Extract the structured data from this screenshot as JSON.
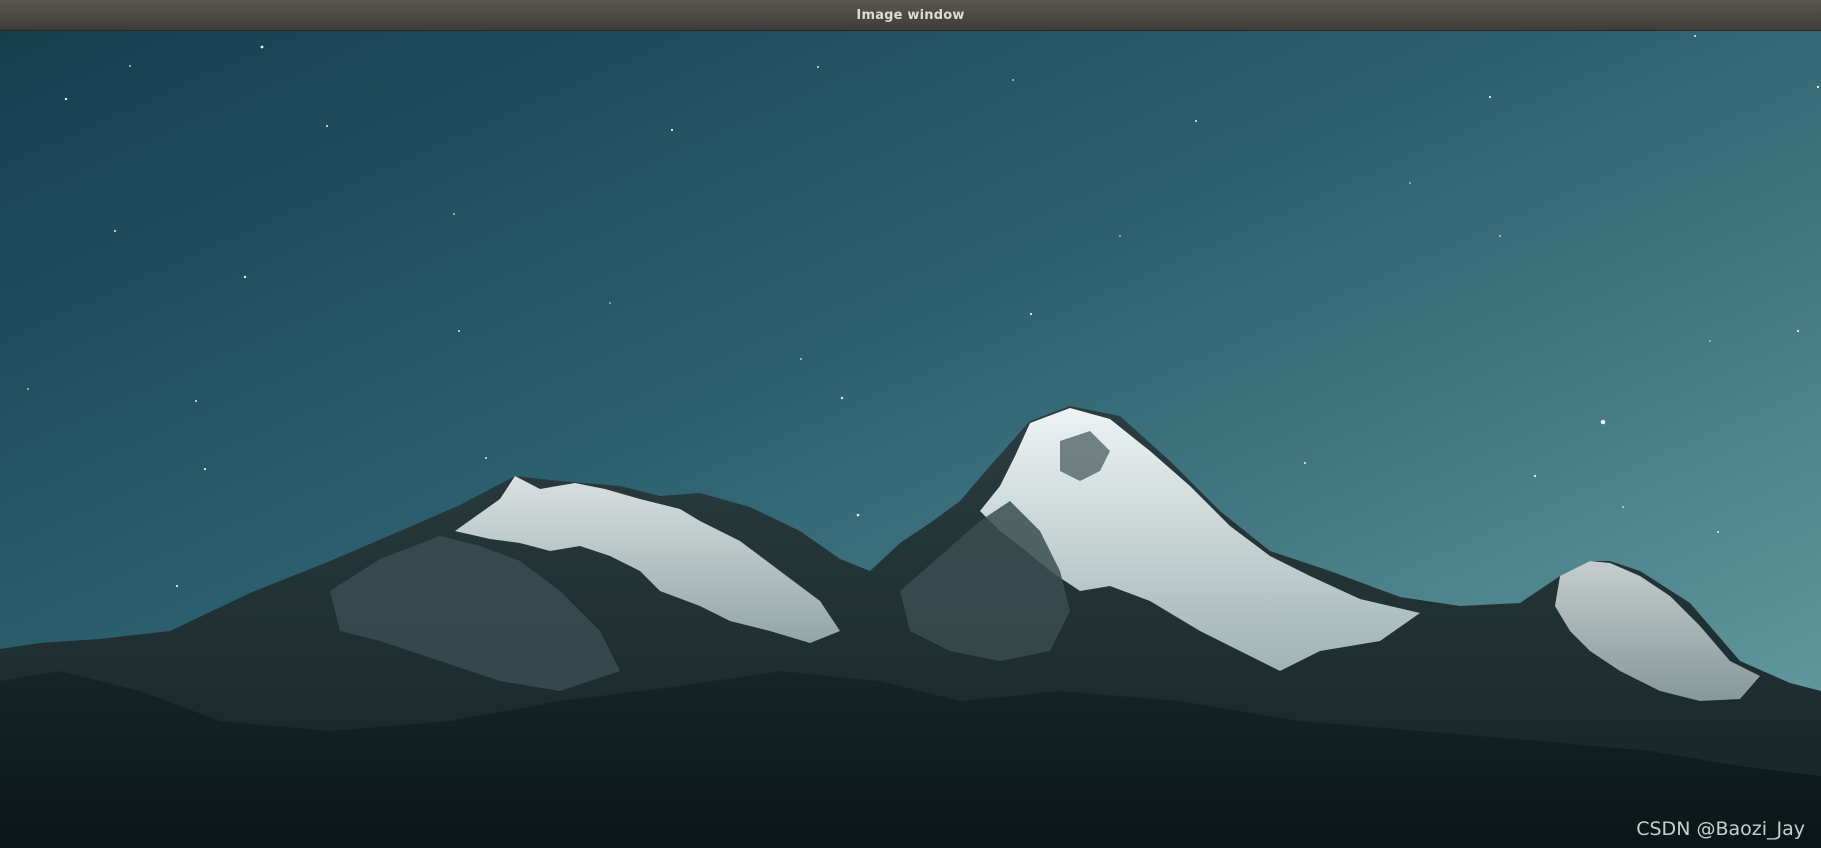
{
  "window": {
    "title": "Image window"
  },
  "image": {
    "subject": "mountain-night-sky",
    "colors": {
      "sky_top": "#1d4656",
      "sky_bottom": "#5a9196",
      "snow": "#dfe8ea",
      "ridge": "#1a2a2c",
      "foreground": "#0c1a1c"
    }
  },
  "watermark": {
    "text": "CSDN @Baozi_Jay"
  }
}
